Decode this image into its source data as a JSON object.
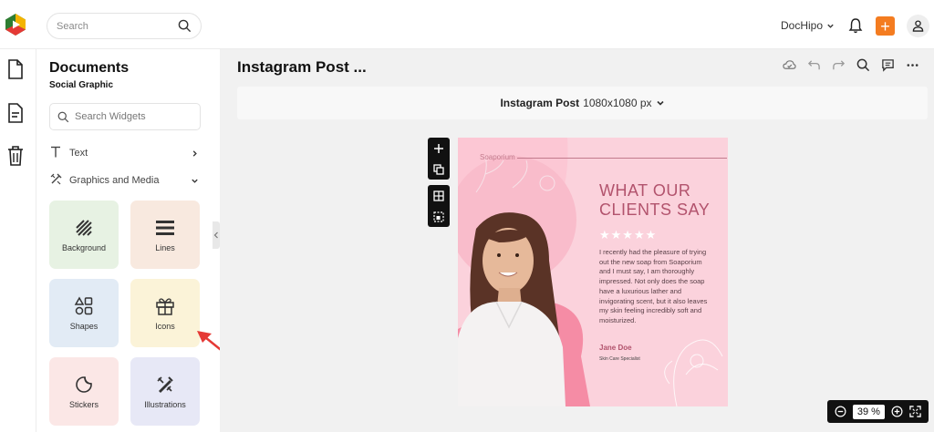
{
  "header": {
    "search_placeholder": "Search",
    "brand": "DocHipo"
  },
  "panel": {
    "title": "Documents",
    "subtitle": "Social Graphic",
    "widget_search_placeholder": "Search Widgets",
    "sections": [
      {
        "label": "Text",
        "chevron": "right"
      },
      {
        "label": "Graphics and Media",
        "chevron": "down"
      }
    ],
    "tiles": [
      {
        "label": "Background",
        "icon": "background-icon",
        "color": "#e7f2e3"
      },
      {
        "label": "Lines",
        "icon": "lines-icon",
        "color": "#f8e9df"
      },
      {
        "label": "Shapes",
        "icon": "shapes-icon",
        "color": "#e2ebf5"
      },
      {
        "label": "Icons",
        "icon": "gift-icon",
        "color": "#fbf3d8"
      },
      {
        "label": "Stickers",
        "icon": "sticker-icon",
        "color": "#fbe7e6"
      },
      {
        "label": "Illustrations",
        "icon": "illustrations-icon",
        "color": "#e7e8f6"
      }
    ]
  },
  "document": {
    "title": "Instagram Post ...",
    "size_name": "Instagram Post",
    "size_dims": "1080x1080 px"
  },
  "design": {
    "brand": "Soaporium",
    "headline_1": "WHAT OUR",
    "headline_2": "CLIENTS SAY",
    "stars": "★★★★★",
    "review": "I recently had the pleasure of trying out the new soap from Soaporium and I must say, I am thoroughly impressed. Not only does the soap have a luxurious lather and invigorating scent, but it also leaves my skin feeling incredibly soft and moisturized.",
    "author": "Jane Doe",
    "role": "Skin Care Specialist"
  },
  "zoom": {
    "value": "39",
    "unit": "%"
  },
  "colors": {
    "accent": "#f47c20",
    "canvas": "#fbd2dc",
    "headline": "#b2536d",
    "arrow": "#e53935"
  }
}
